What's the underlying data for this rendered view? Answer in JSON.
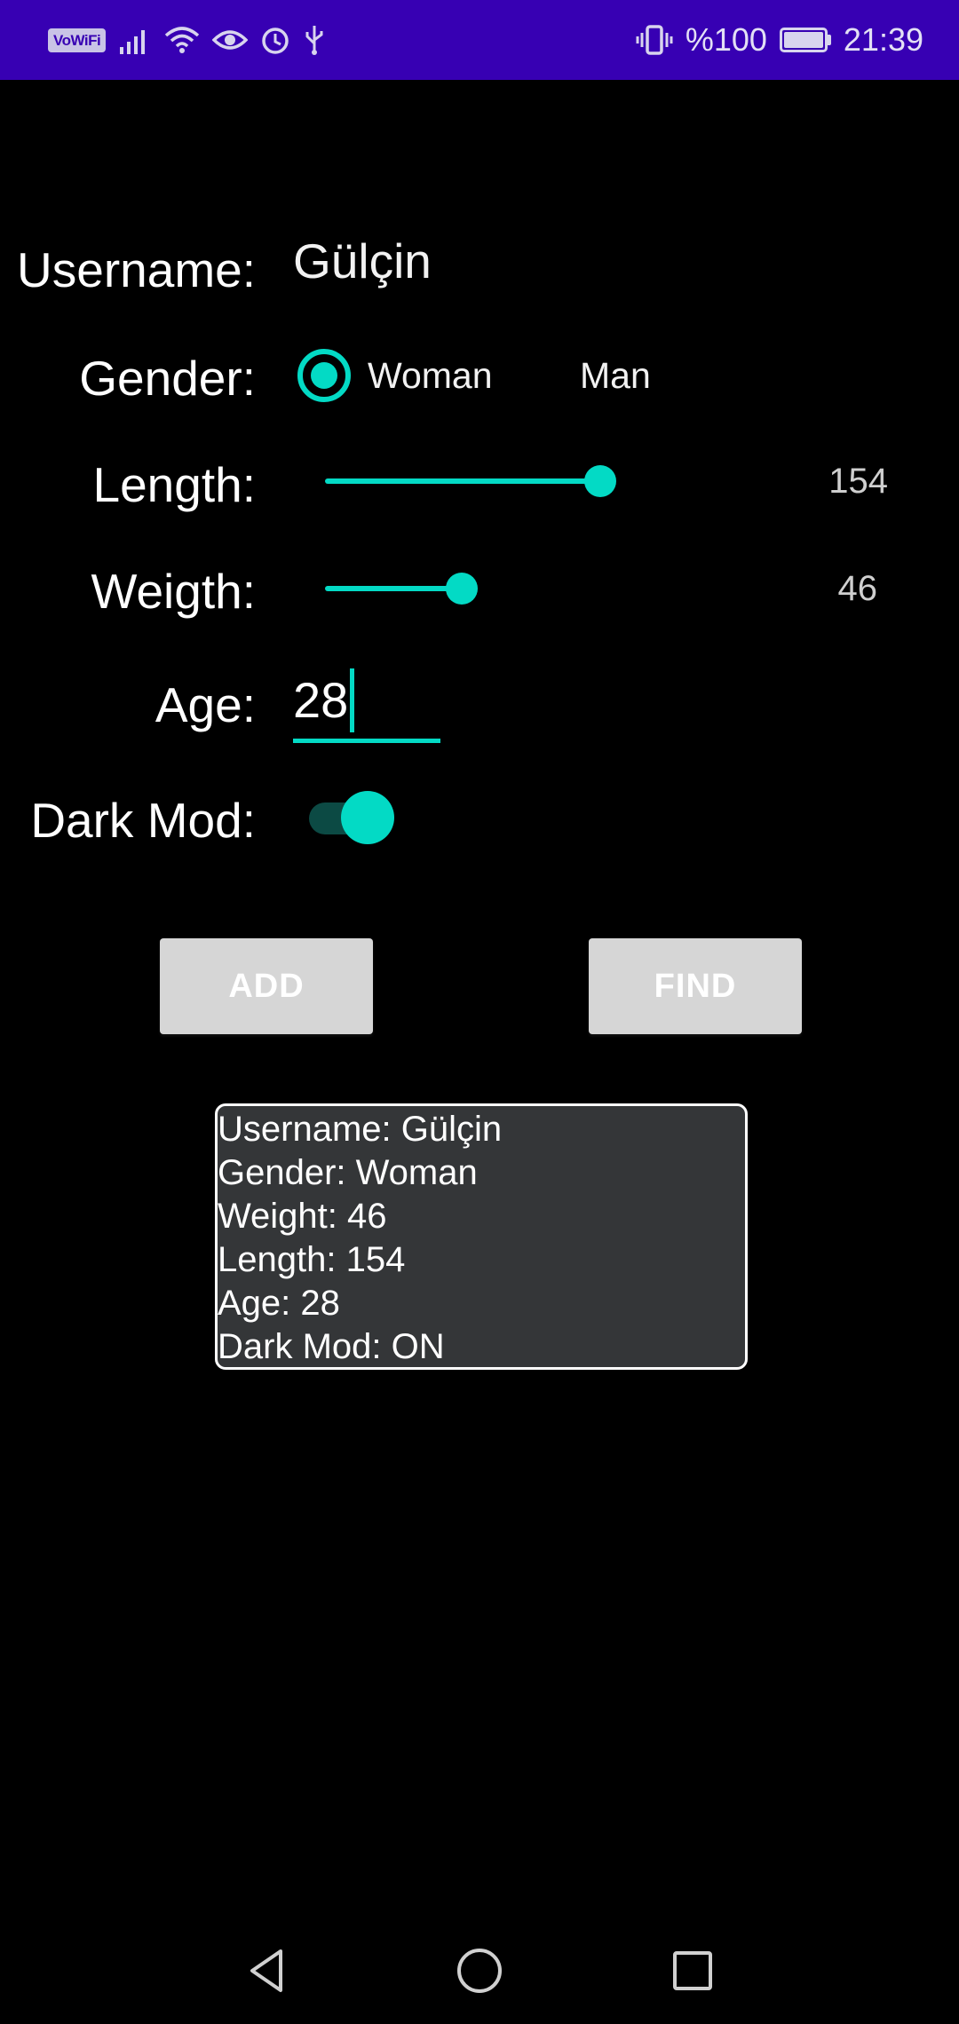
{
  "status_bar": {
    "vowifi": "VoWiFi",
    "battery_percent": "%100",
    "time": "21:39",
    "icons": [
      "vowifi-icon",
      "signal-icon",
      "wifi-icon",
      "eye-icon",
      "alarm-icon",
      "usb-icon",
      "vibrate-icon",
      "battery-charging-icon"
    ]
  },
  "form": {
    "username_label": "Username:",
    "username_value": "Gülçin",
    "gender_label": "Gender:",
    "gender_options": [
      "Woman",
      "Man"
    ],
    "gender_selected": "Woman",
    "length_label": "Length:",
    "length_value": "154",
    "weight_label": "Weigth:",
    "weight_value": "46",
    "age_label": "Age:",
    "age_value": "28",
    "dark_mode_label": "Dark Mod:",
    "dark_mode_on": true
  },
  "buttons": {
    "add": "ADD",
    "find": "FIND"
  },
  "result": {
    "lines": [
      "Username: Gülçin",
      "Gender: Woman",
      "Weight: 46",
      "Length: 154",
      "Age: 28",
      "Dark Mod: ON"
    ]
  },
  "nav_bar": {
    "icons": [
      "back-icon",
      "home-icon",
      "recents-icon"
    ]
  },
  "colors": {
    "status_bar": "#3700b3",
    "accent": "#03dac5",
    "background": "#000000",
    "button": "#d6d6d6",
    "result_box": "#343638"
  }
}
